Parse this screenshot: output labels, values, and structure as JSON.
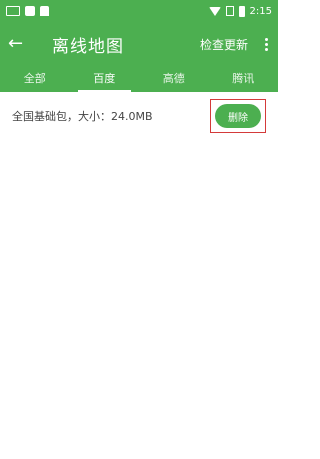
{
  "statusbar": {
    "time": "2:15"
  },
  "appbar": {
    "back_glyph": "←",
    "title": "离线地图",
    "check_update": "检查更新"
  },
  "tabs": [
    {
      "label": "全部"
    },
    {
      "label": "百度"
    },
    {
      "label": "高德"
    },
    {
      "label": "腾讯"
    }
  ],
  "list": {
    "items": [
      {
        "text": "全国基础包，大小：24.0MB",
        "action": "删除"
      }
    ]
  }
}
